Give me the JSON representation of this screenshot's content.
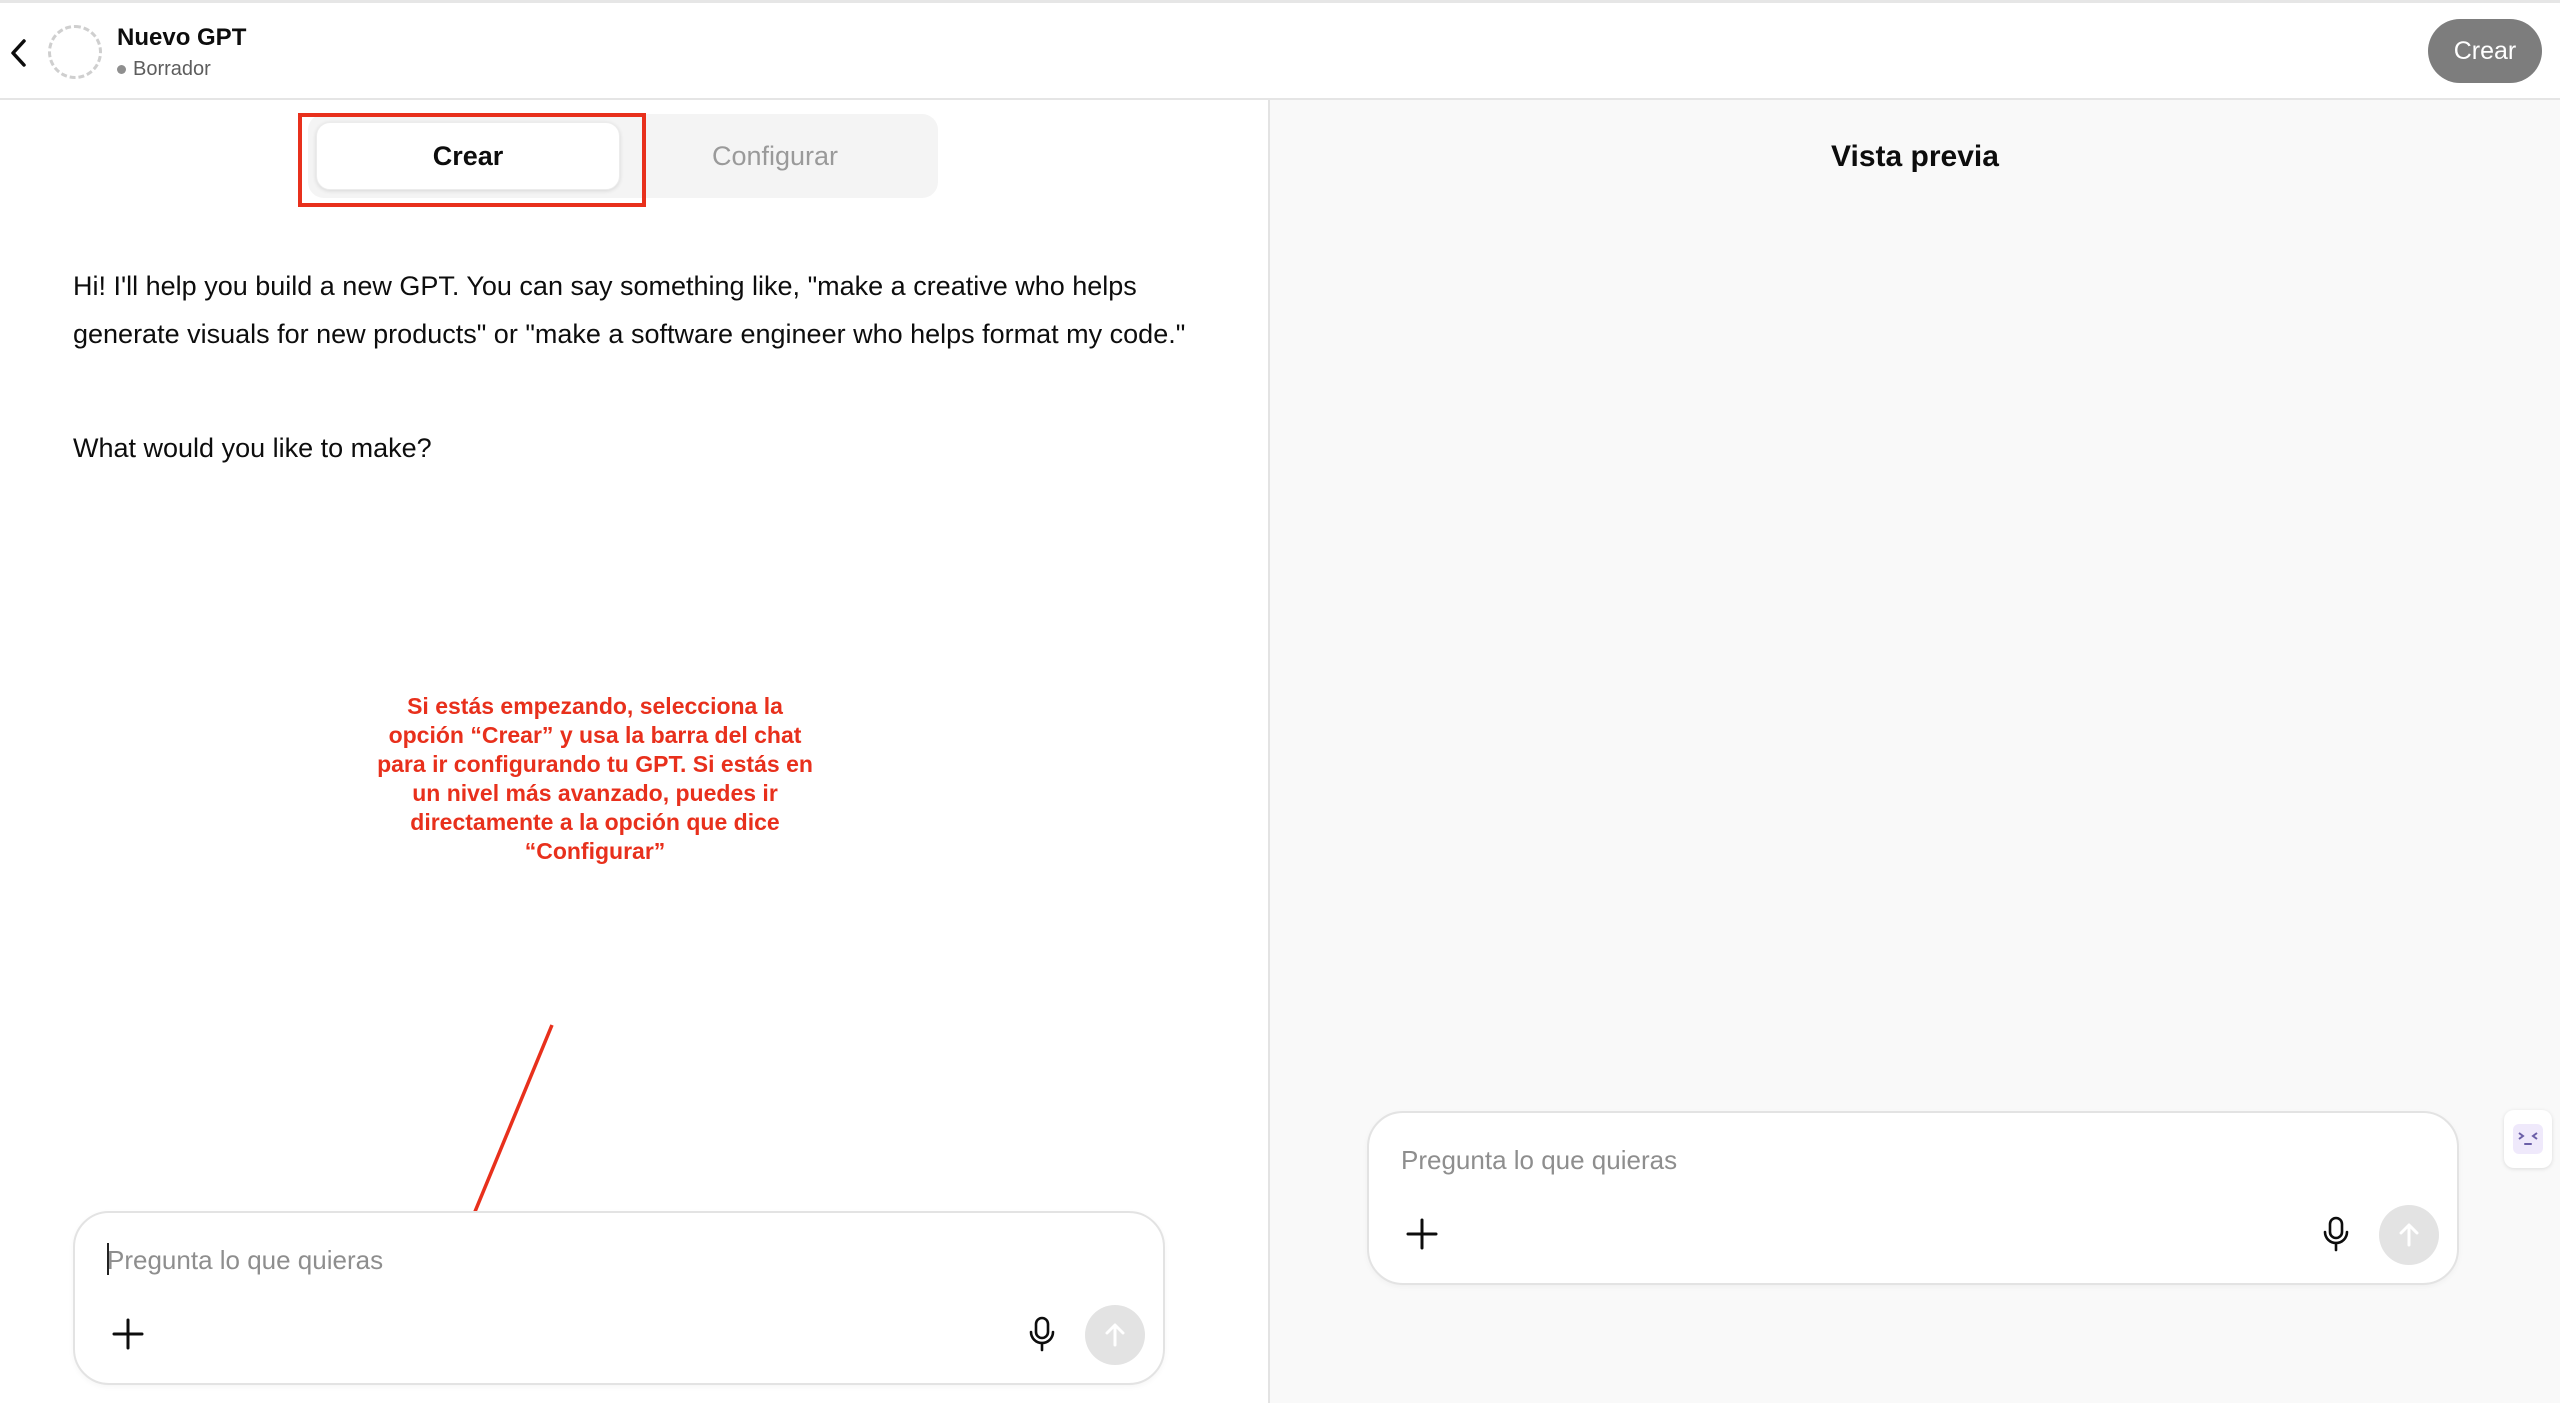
{
  "header": {
    "title": "Nuevo GPT",
    "status": "Borrador",
    "create_button": "Crear"
  },
  "builder": {
    "tabs": [
      {
        "label": "Crear",
        "active": true
      },
      {
        "label": "Configurar",
        "active": false
      }
    ],
    "messages": {
      "intro": "Hi! I'll help you build a new GPT. You can say something like, \"make a creative who helps generate visuals for new products\" or \"make a software engineer who helps format my code.\"",
      "question": "What would you like to make?"
    },
    "annotation": "Si estás empezando, selecciona la opción “Crear” y usa la barra del chat para ir configurando tu GPT. Si estás en un nivel más avanzado, puedes ir directamente a la opción que dice “Configurar”",
    "composer": {
      "placeholder": "Pregunta lo que quieras",
      "value": ""
    }
  },
  "preview": {
    "title": "Vista previa",
    "composer": {
      "placeholder": "Pregunta lo que quieras",
      "value": ""
    }
  },
  "icons": {
    "back": "chevron-left-icon",
    "avatar": "dashed-circle-avatar",
    "plus": "plus-icon",
    "mic": "microphone-icon",
    "send": "arrow-up-icon",
    "widget": "face-emoji-icon"
  },
  "colors": {
    "annotation": "#e8301c",
    "header_button": "#7d7d7d",
    "send_button": "#e3e3e3",
    "preview_bg": "#f9f9f9"
  }
}
